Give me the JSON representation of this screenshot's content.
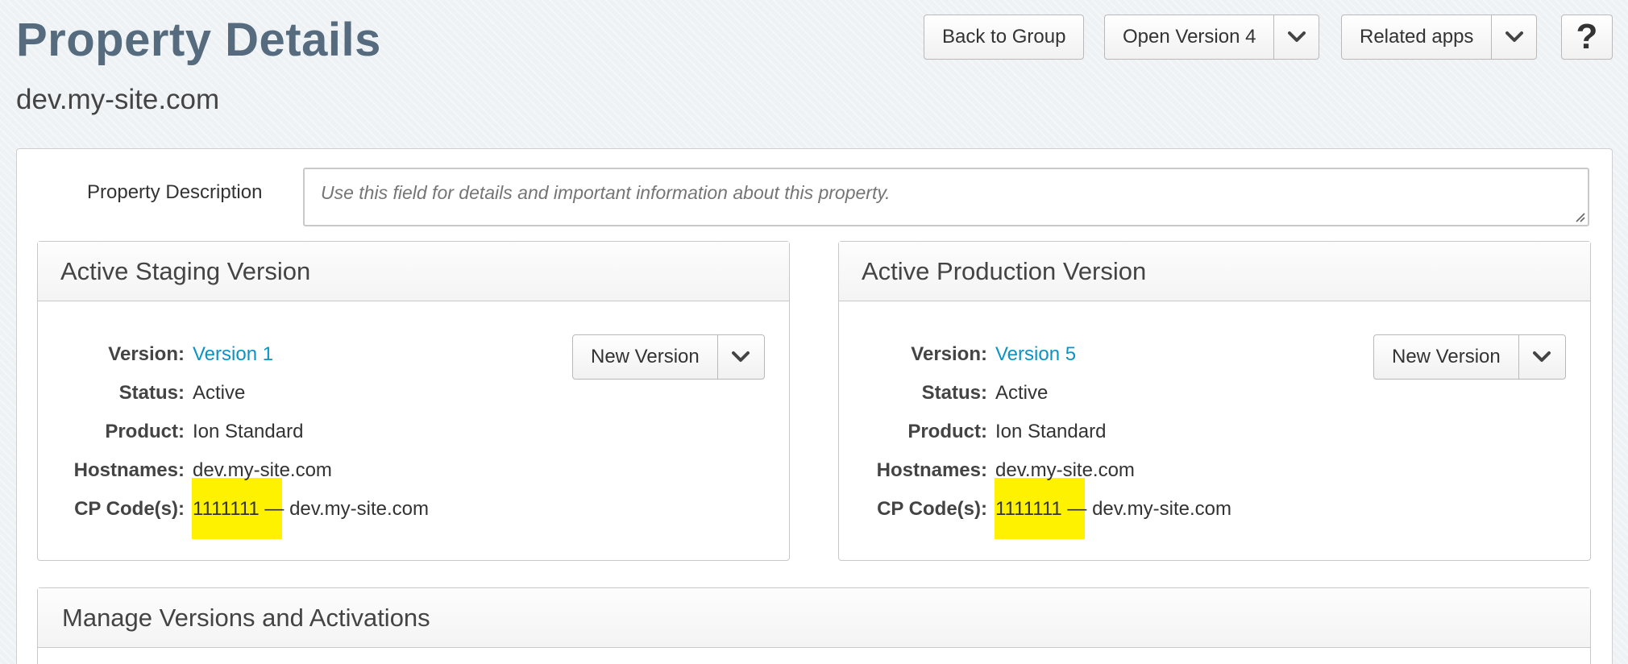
{
  "header": {
    "title": "Property Details",
    "subtitle": "dev.my-site.com",
    "back_label": "Back to Group",
    "open_version_label": "Open Version 4",
    "related_apps_label": "Related apps",
    "help_label": "?"
  },
  "description": {
    "label": "Property Description",
    "placeholder": "Use this field for details and important information about this property."
  },
  "staging": {
    "title": "Active Staging Version",
    "new_version_label": "New Version",
    "labels": {
      "version": "Version:",
      "status": "Status:",
      "product": "Product:",
      "hostnames": "Hostnames:",
      "cpcodes": "CP Code(s):"
    },
    "version": "Version 1",
    "status": "Active",
    "product": "Ion Standard",
    "hostnames": "dev.my-site.com",
    "cpcode": "1111111",
    "cpcode_host": " — dev.my-site.com"
  },
  "production": {
    "title": "Active Production Version",
    "new_version_label": "New Version",
    "labels": {
      "version": "Version:",
      "status": "Status:",
      "product": "Product:",
      "hostnames": "Hostnames:",
      "cpcodes": "CP Code(s):"
    },
    "version": "Version 5",
    "status": "Active",
    "product": "Ion Standard",
    "hostnames": "dev.my-site.com",
    "cpcode": "1111111",
    "cpcode_host": " — dev.my-site.com"
  },
  "manage": {
    "title": "Manage Versions and Activations"
  },
  "colors": {
    "title": "#566b7e",
    "link": "#0a93c5",
    "highlight": "#fff200"
  }
}
